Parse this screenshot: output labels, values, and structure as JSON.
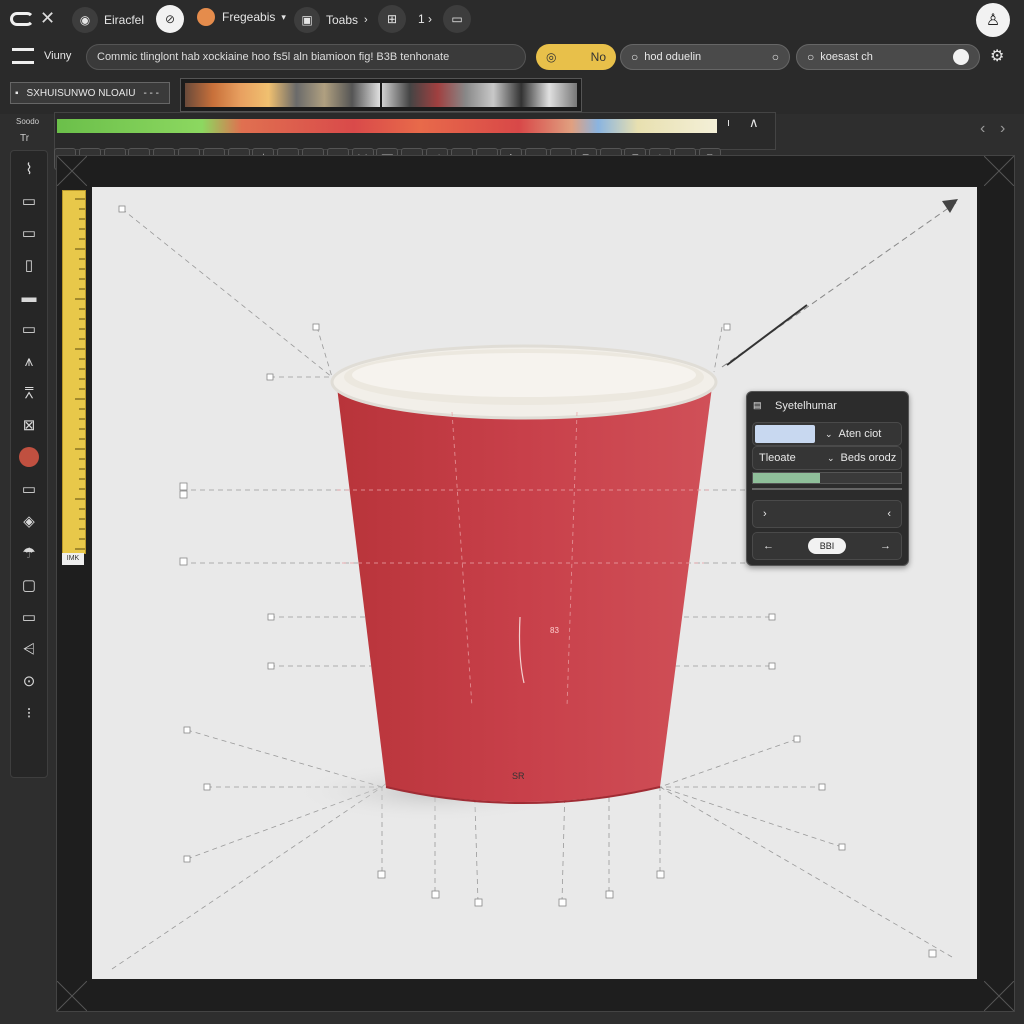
{
  "topbar": {
    "app_label": "Eiracfel",
    "tab2_label": "Fregeabis",
    "tab3_label": "Toabs",
    "page_indicator": "1 ›",
    "tab2_dot_color": "#e58c4c"
  },
  "row2": {
    "view_label": "Viuny",
    "path_text": "Commic tlinglont hab  xockiaine hoo  fs5l aln biamioon fig! B3B tenhonate",
    "toggle_no": "No",
    "field1_label": "hod oduelin",
    "field2_label": "koesast ch",
    "accent_yellow": "#e8c04a"
  },
  "row3": {
    "layer_label": "SXHUISUNWO NLOAIU",
    "layer_menu": "- - -"
  },
  "rail": {
    "label1": "Soodo",
    "label2": "Tr",
    "ruler_label": "IMK"
  },
  "canvas": {
    "cup_label_mid": "83",
    "cup_label_bottom": "SR"
  },
  "panel": {
    "title": "Syetelhumar",
    "row1_value": "Aten ciot",
    "row2_label": "Tleoate",
    "row2_value": "Beds orodz",
    "progress": 0.45,
    "nav_center": "BBI",
    "swatch_color": "#c8d8f0"
  }
}
